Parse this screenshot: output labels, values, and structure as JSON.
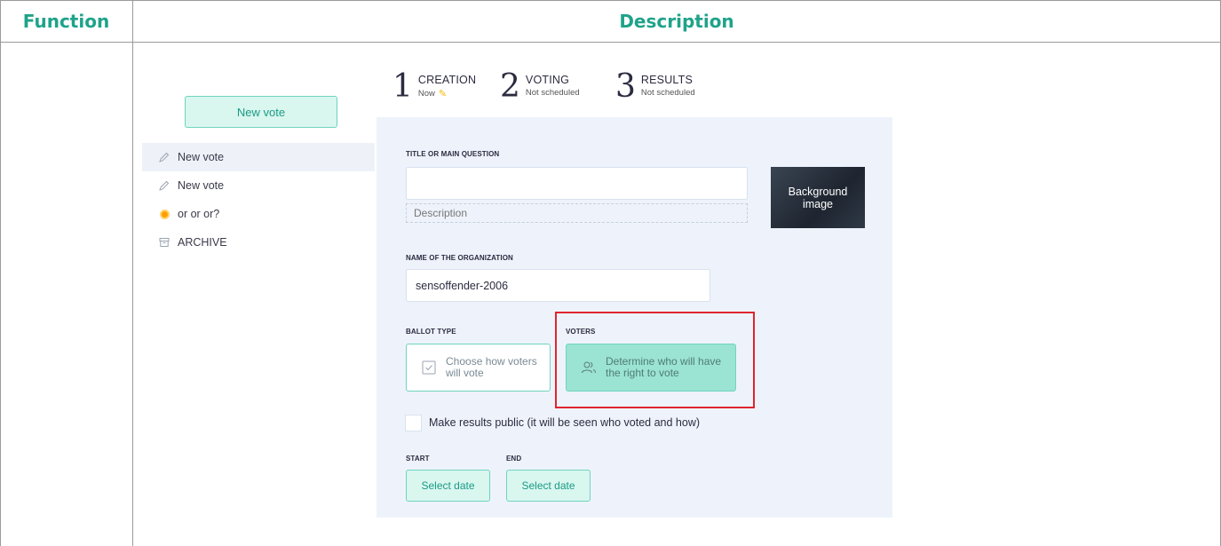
{
  "table": {
    "function_header": "Function",
    "description_header": "Description"
  },
  "sidebar": {
    "new_vote_button": "New vote",
    "items": [
      {
        "label": "New vote",
        "icon": "pencil-icon",
        "active": true
      },
      {
        "label": "New vote",
        "icon": "pencil-icon",
        "active": false
      },
      {
        "label": "or or or?",
        "icon": "status-dot-icon",
        "active": false
      },
      {
        "label": "ARCHIVE",
        "icon": "archive-icon",
        "active": false
      }
    ]
  },
  "steps": [
    {
      "num": "1",
      "title": "CREATION",
      "sub": "Now"
    },
    {
      "num": "2",
      "title": "VOTING",
      "sub": "Not scheduled"
    },
    {
      "num": "3",
      "title": "RESULTS",
      "sub": "Not scheduled"
    }
  ],
  "form": {
    "title_label": "TITLE OR MAIN QUESTION",
    "title_value": "",
    "description_placeholder": "Description",
    "background_image_label": "Background image",
    "org_label": "NAME OF THE ORGANIZATION",
    "org_value": "sensoffender-2006",
    "ballot_label": "BALLOT TYPE",
    "ballot_text": "Choose how voters will vote",
    "voters_label": "VOTERS",
    "voters_text": "Determine who will have the right to vote",
    "public_results_label": "Make results public (it will be seen who voted and how)",
    "start_label": "START",
    "end_label": "END",
    "start_date_button": "Select date",
    "end_date_button": "Select date"
  },
  "colors": {
    "accent": "#1fa38a",
    "button_bg": "#d9f6ef",
    "selected_bg": "#9be3d2",
    "highlight": "#e0242f",
    "panel_bg": "#eef3fb"
  }
}
